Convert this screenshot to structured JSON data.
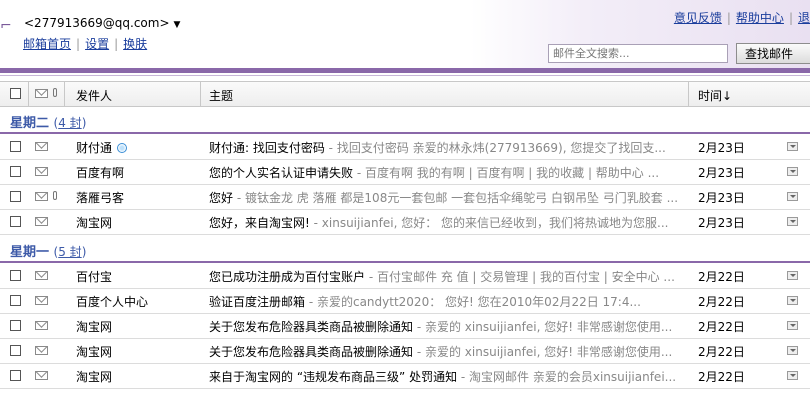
{
  "header": {
    "account": "<277913669@qq.com>",
    "nav": [
      "邮箱首页",
      "设置",
      "换肤"
    ],
    "top_links": [
      "意见反馈",
      "帮助中心",
      "退"
    ],
    "search_placeholder": "邮件全文搜索...",
    "search_button": "查找邮件"
  },
  "columns": {
    "sender": "发件人",
    "subject": "主题",
    "time": "时间↓"
  },
  "groups": [
    {
      "label": "星期二",
      "count_prefix": "(",
      "count": "4 封",
      "count_suffix": ")",
      "rows": [
        {
          "sender": "财付通",
          "subject": "财付通: 找回支付密码",
          "preview": " - 找回支付密码 亲爱的林永炜(277913669), 您提交了找回支...",
          "date": "2月23日",
          "badge": true,
          "attachment": false
        },
        {
          "sender": "百度有啊",
          "subject": "您的个人实名认证申请失败",
          "preview": " - 百度有啊    我的有啊 | 百度有啊 | 我的收藏 | 帮助中心 ...",
          "date": "2月23日",
          "badge": false,
          "attachment": false
        },
        {
          "sender": "落雁弓客",
          "subject": "您好",
          "preview": " - 镀钛金龙 虎 落雁 都是108元一套包邮 一套包括伞绳鸵弓 白钢吊坠 弓门乳胶套 ...",
          "date": "2月23日",
          "badge": false,
          "attachment": true
        },
        {
          "sender": "淘宝网",
          "subject": "您好，来自淘宝网!",
          "preview": " - xinsuijianfei, 您好： 您的来信已经收到，我们将热诚地为您服...",
          "date": "2月23日",
          "badge": false,
          "attachment": false
        }
      ]
    },
    {
      "label": "星期一",
      "count_prefix": "(",
      "count": "5 封",
      "count_suffix": ")",
      "rows": [
        {
          "sender": "百付宝",
          "subject": "您已成功注册成为百付宝账户",
          "preview": " - 百付宝邮件 充 值 | 交易管理 | 我的百付宝 | 安全中心 ...",
          "date": "2月22日",
          "badge": false,
          "attachment": false
        },
        {
          "sender": "百度个人中心",
          "subject": "验证百度注册邮箱",
          "preview": " - 亲爱的candytt2020：      您好! 您在2010年02月22日 17:4...",
          "date": "2月22日",
          "badge": false,
          "attachment": false
        },
        {
          "sender": "淘宝网",
          "subject": "关于您发布危险器具类商品被删除通知",
          "preview": " - 亲爱的 xinsuijianfei, 您好! 非常感谢您使用...",
          "date": "2月22日",
          "badge": false,
          "attachment": false
        },
        {
          "sender": "淘宝网",
          "subject": "关于您发布危险器具类商品被删除通知",
          "preview": " - 亲爱的 xinsuijianfei, 您好! 非常感谢您使用...",
          "date": "2月22日",
          "badge": false,
          "attachment": false
        },
        {
          "sender": "淘宝网",
          "subject": "来自于淘宝网的 “违规发布商品三级” 处罚通知",
          "preview": " - 淘宝网邮件 亲爱的会员xinsuijianfei...",
          "date": "2月22日",
          "badge": false,
          "attachment": false
        }
      ]
    }
  ],
  "colors": {
    "accent": "#8a68a9",
    "link": "#1a3d9c",
    "group_title": "#3d5aa8"
  }
}
